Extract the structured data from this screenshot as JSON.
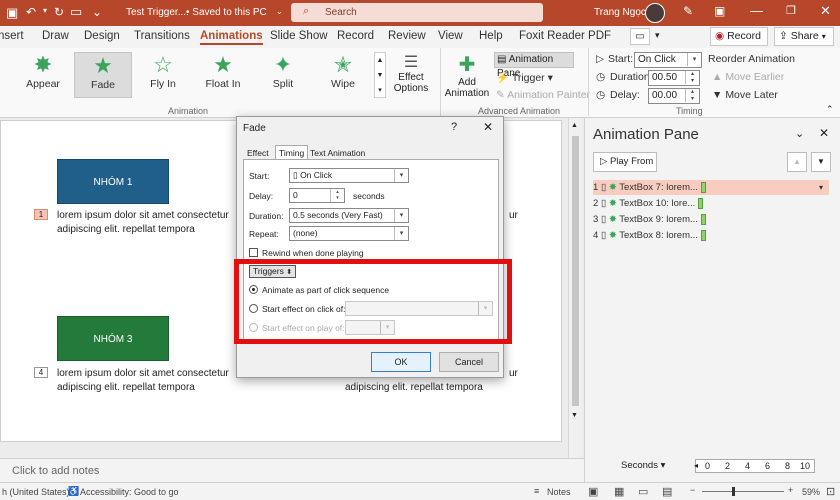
{
  "window": {
    "title": "Test Trigger....",
    "saved": "• Saved to this PC",
    "search_placeholder": "Search",
    "user": "Trang Ngọc"
  },
  "tabs": [
    "nsert",
    "Draw",
    "Design",
    "Transitions",
    "Animations",
    "Slide Show",
    "Record",
    "Review",
    "View",
    "Help",
    "Foxit Reader PDF"
  ],
  "ribbon_actions": {
    "record": "Record",
    "share": "Share"
  },
  "effects": [
    "Appear",
    "Fade",
    "Fly In",
    "Float In",
    "Split",
    "Wipe"
  ],
  "effect_options": "Effect Options",
  "group_labels": {
    "animation": "Animation",
    "advanced": "Advanced Animation",
    "timing": "Timing"
  },
  "advanced": {
    "add_animation": "Add Animation",
    "animation_pane": "Animation Pane",
    "trigger": "Trigger",
    "animation_painter": "Animation Painter"
  },
  "timing": {
    "start_label": "Start:",
    "start_value": "On Click",
    "duration_label": "Duration:",
    "duration_value": "00.50",
    "delay_label": "Delay:",
    "delay_value": "00.00",
    "reorder": "Reorder Animation",
    "move_earlier": "Move Earlier",
    "move_later": "Move Later"
  },
  "slide": {
    "box1": "NHÓM 1",
    "box3": "NHÓM 3",
    "lorem": "lorem ipsum dolor sit amet consectetur",
    "lorem2": "adipiscing elit. repellat tempora",
    "lorem_r1": "ur",
    "lorem_r2": "adipiscing elit. repellat tempora",
    "num1": "1",
    "num4": "4"
  },
  "notes_placeholder": "Click to add notes",
  "status": {
    "lang": "h (United States)",
    "accessibility": "Accessibility: Good to go",
    "notes": "Notes",
    "zoom": "59%"
  },
  "pane": {
    "title": "Animation Pane",
    "play_from": "Play From",
    "items": [
      {
        "n": "1",
        "label": "TextBox 7: lorem..."
      },
      {
        "n": "2",
        "label": "TextBox 10: lore..."
      },
      {
        "n": "3",
        "label": "TextBox 9: lorem..."
      },
      {
        "n": "4",
        "label": "TextBox 8: lorem..."
      }
    ],
    "seconds": "Seconds",
    "ticks": [
      "0",
      "2",
      "4",
      "6",
      "8",
      "10"
    ]
  },
  "dialog": {
    "title": "Fade",
    "help": "?",
    "tabs": [
      "Effect",
      "Timing",
      "Text Animation"
    ],
    "start_label": "Start:",
    "start_value": "On Click",
    "delay_label": "Delay:",
    "delay_value": "0",
    "seconds": "seconds",
    "duration_label": "Duration:",
    "duration_value": "0.5 seconds (Very Fast)",
    "repeat_label": "Repeat:",
    "repeat_value": "(none)",
    "rewind": "Rewind when done playing",
    "triggers": "Triggers",
    "opt1": "Animate as part of click sequence",
    "opt2": "Start effect on click of:",
    "opt3": "Start effect on play of:",
    "ok": "OK",
    "cancel": "Cancel"
  }
}
